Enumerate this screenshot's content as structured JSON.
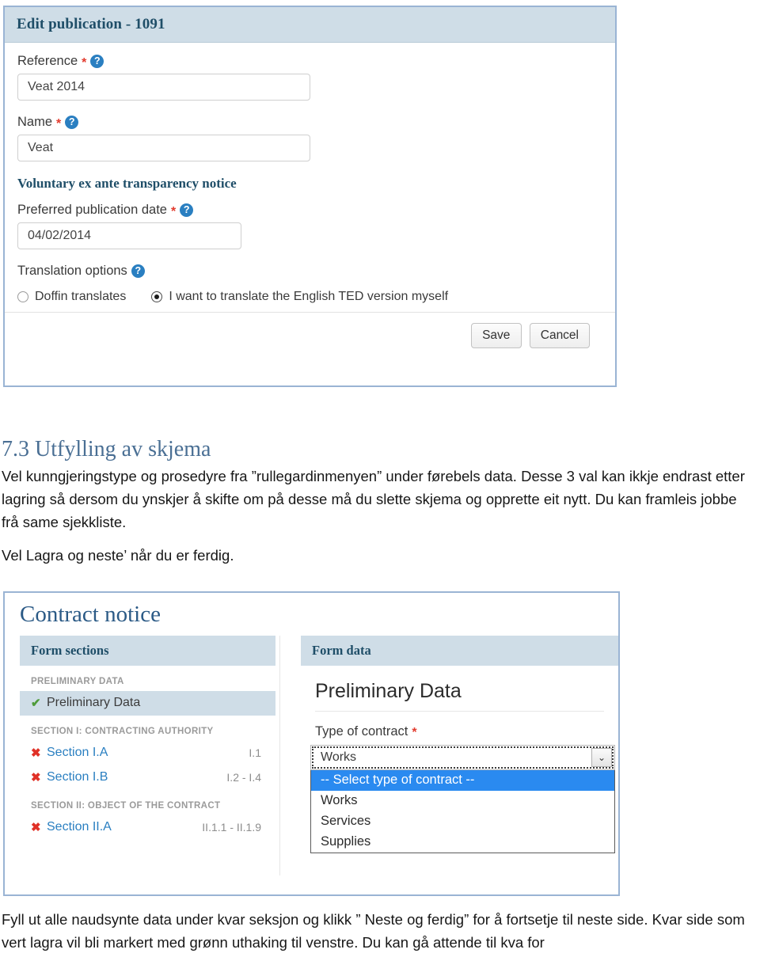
{
  "publication_form": {
    "title": "Edit publication - 1091",
    "help_glyph": "?",
    "required_marker": "*",
    "fields": [
      {
        "label": "Reference",
        "required": true,
        "value": "Veat 2014",
        "has_help": true
      },
      {
        "label": "Name",
        "required": true,
        "value": "Veat",
        "has_help": true
      }
    ],
    "veat_heading": "Voluntary ex ante transparency notice",
    "publication_date": {
      "label": "Preferred publication date",
      "required": true,
      "has_help": true,
      "value": "04/02/2014"
    },
    "translation": {
      "label": "Translation options",
      "has_help": true,
      "options": [
        {
          "label": "Doffin translates",
          "selected": false
        },
        {
          "label": "I want to translate the English TED version myself",
          "selected": true
        }
      ]
    },
    "buttons": {
      "save": "Save",
      "cancel": "Cancel"
    }
  },
  "prose_top": {
    "heading": "7.3 Utfylling av skjema",
    "paragraphs": [
      "Vel kunngjeringstype og prosedyre fra ”rullegardinmenyen” under førebels data. Desse 3 val kan ikkje endrast etter lagring så dersom du ynskjer å skifte om på desse må du slette  skjema og opprette eit nytt. Du kan framleis jobbe frå same sjekkliste.",
      "Vel Lagra og neste’ når du er ferdig."
    ]
  },
  "contract_notice": {
    "title": "Contract notice",
    "form_sections": {
      "header": "Form sections",
      "groups": [
        {
          "label": "PRELIMINARY DATA",
          "rows": [
            {
              "status": "ok",
              "mark": "✔",
              "name": "Preliminary Data",
              "range": "",
              "active": true
            }
          ]
        },
        {
          "label": "SECTION I: CONTRACTING AUTHORITY",
          "rows": [
            {
              "status": "bad",
              "mark": "✖",
              "name": "Section I.A",
              "range": "I.1",
              "active": false
            },
            {
              "status": "bad",
              "mark": "✖",
              "name": "Section I.B",
              "range": "I.2 - I.4",
              "active": false
            }
          ]
        },
        {
          "label": "SECTION II: OBJECT OF THE CONTRACT",
          "rows": [
            {
              "status": "bad",
              "mark": "✖",
              "name": "Section II.A",
              "range": "II.1.1 - II.1.9",
              "active": false
            }
          ]
        }
      ]
    },
    "form_data": {
      "header": "Form data",
      "page_title": "Preliminary Data",
      "type_of_contract": {
        "label": "Type of contract",
        "required_marker": "*",
        "selected_value": "Works",
        "arrow_glyph": "⌄",
        "open": true,
        "options": [
          {
            "label": "-- Select type of contract --",
            "highlighted": true
          },
          {
            "label": "Works",
            "highlighted": false
          },
          {
            "label": "Services",
            "highlighted": false
          },
          {
            "label": "Supplies",
            "highlighted": false
          }
        ]
      }
    }
  },
  "prose_bottom": {
    "paragraphs": [
      "Fyll ut alle naudsynte data under kvar seksjon og klikk ” Neste og ferdig” for å fortsetje til neste side. Kvar side som vert lagra vil bli markert med grønn uthaking til venstre.  Du kan gå attende til kva for"
    ]
  },
  "colors": {
    "panel_border": "#9ab4d4",
    "titlebar_bg": "#cfdde7",
    "title_text": "#1f4e68",
    "heading_blue": "#4a6f94",
    "link_blue": "#2a7fc1",
    "required_red": "#e23b2e",
    "status_ok_green": "#4e9b3a",
    "status_bad_red": "#e03127",
    "select_highlight": "#2a8af0"
  }
}
